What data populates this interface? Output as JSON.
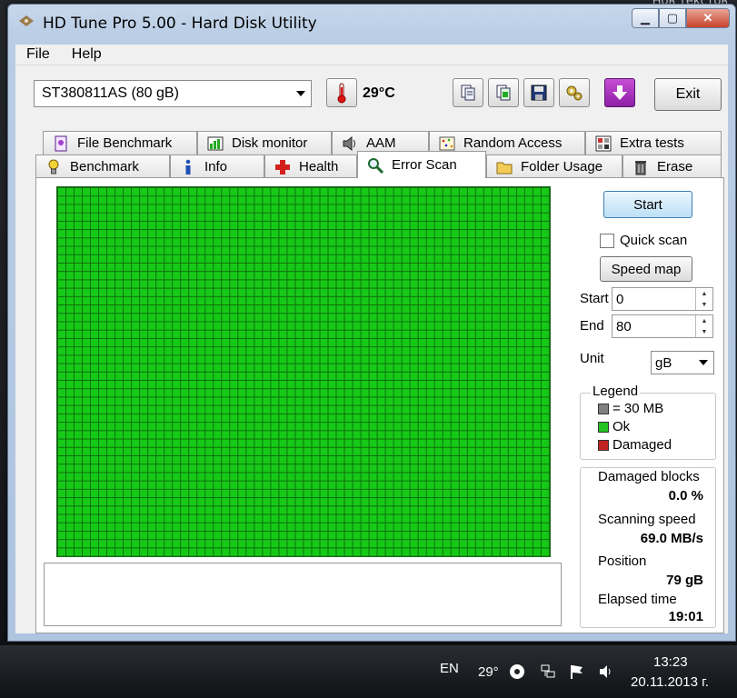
{
  "desktop": {
    "partial_text": "Нов текстов"
  },
  "window": {
    "title": "HD Tune Pro 5.00 - Hard Disk Utility"
  },
  "menu": {
    "file": "File",
    "help": "Help"
  },
  "toolbar": {
    "drive": "ST380811AS (80 gB)",
    "temperature": "29°C",
    "exit_label": "Exit"
  },
  "tabs": {
    "row1": [
      "File Benchmark",
      "Disk monitor",
      "AAM",
      "Random Access",
      "Extra tests"
    ],
    "row2": [
      "Benchmark",
      "Info",
      "Health",
      "Error Scan",
      "Folder Usage",
      "Erase"
    ],
    "active": "Error Scan"
  },
  "scan": {
    "start_label": "Start",
    "quick_scan_label": "Quick scan",
    "quick_scan_checked": false,
    "speed_map_label": "Speed map",
    "start_field_label": "Start",
    "start_value": "0",
    "end_field_label": "End",
    "end_value": "80",
    "unit_label": "Unit",
    "unit_value": "gB",
    "legend_title": "Legend",
    "legend": [
      {
        "label": "= 30 MB",
        "color": "#808080"
      },
      {
        "label": "Ok",
        "color": "#22c322"
      },
      {
        "label": "Damaged",
        "color": "#c32222"
      }
    ],
    "grid_color": "#17c917"
  },
  "stats": {
    "damaged_blocks_label": "Damaged blocks",
    "damaged_blocks_value": "0.0 %",
    "scanning_speed_label": "Scanning speed",
    "scanning_speed_value": "69.0 MB/s",
    "position_label": "Position",
    "position_value": "79 gB",
    "elapsed_label": "Elapsed time",
    "elapsed_value": "19:01"
  },
  "taskbar": {
    "language": "EN",
    "weather": "29°",
    "time": "13:23",
    "date": "20.11.2013 г."
  }
}
